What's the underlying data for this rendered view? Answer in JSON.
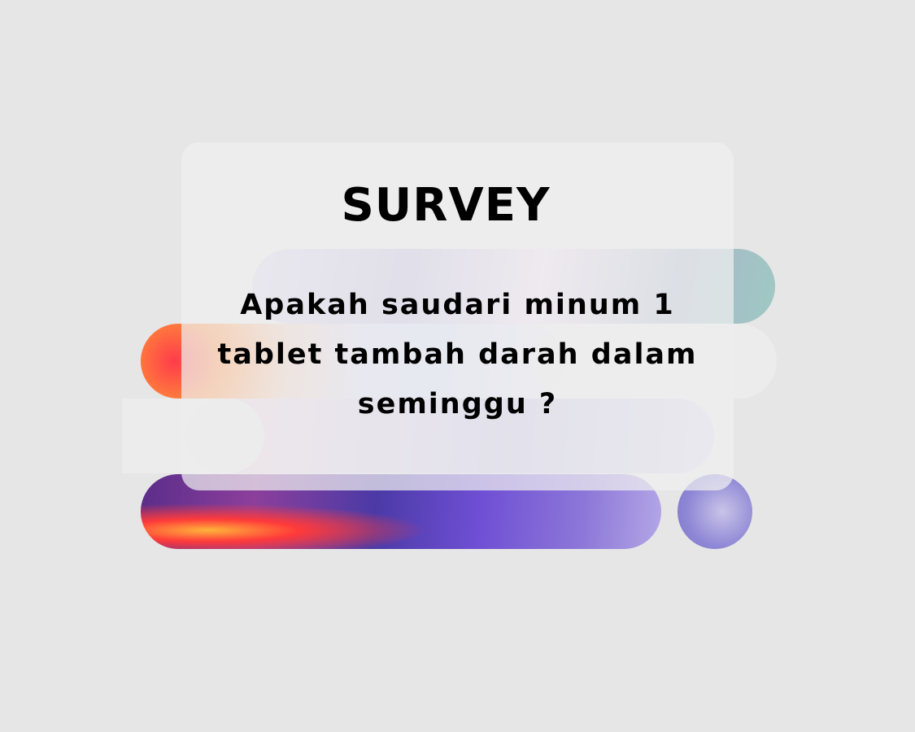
{
  "survey": {
    "title": "SURVEY",
    "question": "Apakah saudari minum 1 tablet tambah darah dalam seminggu ?"
  },
  "colors": {
    "background": "#e6e6e6",
    "card": "#f0f0f0",
    "text": "#000000",
    "holo_warm": "#ff5a3c",
    "holo_purple": "#6a4fd2",
    "holo_teal": "#9fc9c4"
  }
}
